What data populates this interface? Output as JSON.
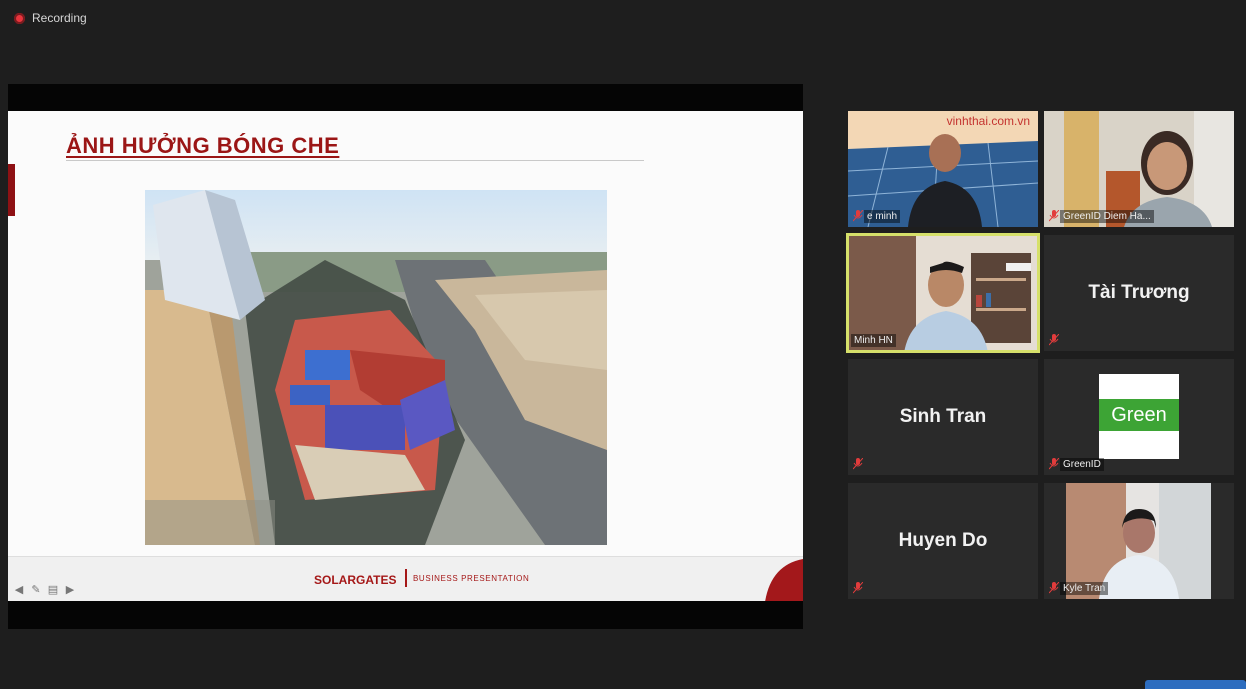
{
  "recording": {
    "label": "Recording"
  },
  "slide": {
    "title": "ẢNH HƯỞNG BÓNG CHE",
    "footer_brand": "SOLARGATES",
    "footer_subtitle": "BUSINESS PRESENTATION",
    "accent_color": "#9b1616"
  },
  "participants": [
    {
      "name": "e minh",
      "overlay_text": "vinhthai.com.vn",
      "video": true,
      "muted": true
    },
    {
      "name": "GreenID Diem Ha...",
      "video": true,
      "muted": true
    },
    {
      "name": "Minh HN",
      "video": true,
      "muted": false,
      "active_speaker": true
    },
    {
      "name": "Tài Trương",
      "video": false,
      "muted": true
    },
    {
      "name": "Sinh Tran",
      "video": false,
      "muted": true
    },
    {
      "name": "GreenID",
      "logo_text": "Green",
      "video": false,
      "muted": true
    },
    {
      "name": "Huyen Do",
      "video": false,
      "muted": true
    },
    {
      "name": "Kyle Tran",
      "video": true,
      "muted": true
    }
  ]
}
